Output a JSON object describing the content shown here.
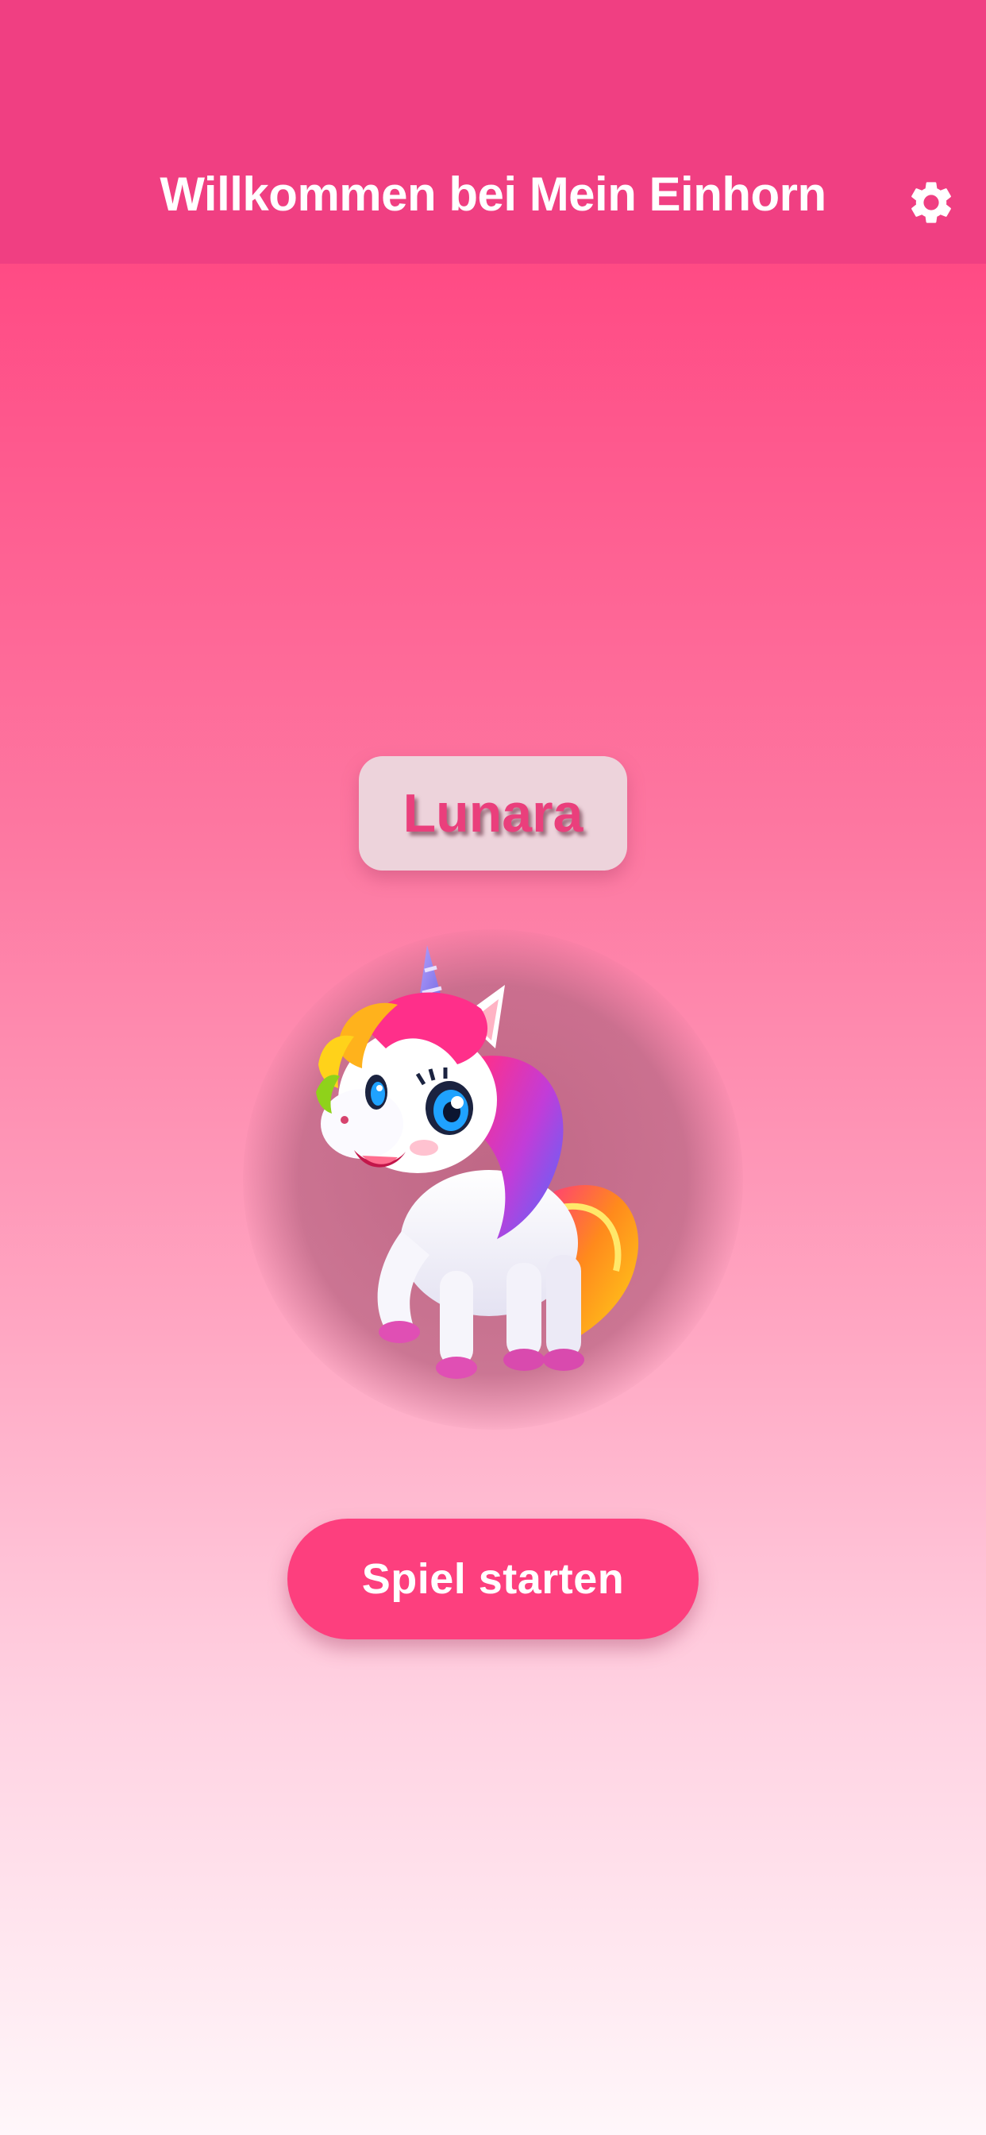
{
  "app_bar": {
    "title": "Willkommen bei Mein Einhorn",
    "settings_icon": "gear-icon"
  },
  "pet": {
    "name": "Lunara",
    "image": "unicorn-illustration"
  },
  "actions": {
    "start_label": "Spiel starten"
  },
  "colors": {
    "app_bar": "#f03f82",
    "accent": "#fd3f7e",
    "name_text": "#ea3f7c",
    "gradient_top": "#ff3d7c",
    "gradient_bottom": "#fff7fa"
  }
}
